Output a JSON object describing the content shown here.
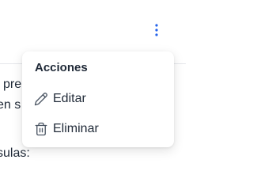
{
  "header": {
    "menu_button_icon": "kebab-vertical-icon",
    "accent_color": "#2563eb"
  },
  "background_text": {
    "line1": "l pre",
    "line2": "en s",
    "line3": "sulas:"
  },
  "menu": {
    "title": "Acciones",
    "items": [
      {
        "label": "Editar",
        "icon": "pencil-icon"
      },
      {
        "label": "Eliminar",
        "icon": "trash-icon"
      }
    ]
  }
}
